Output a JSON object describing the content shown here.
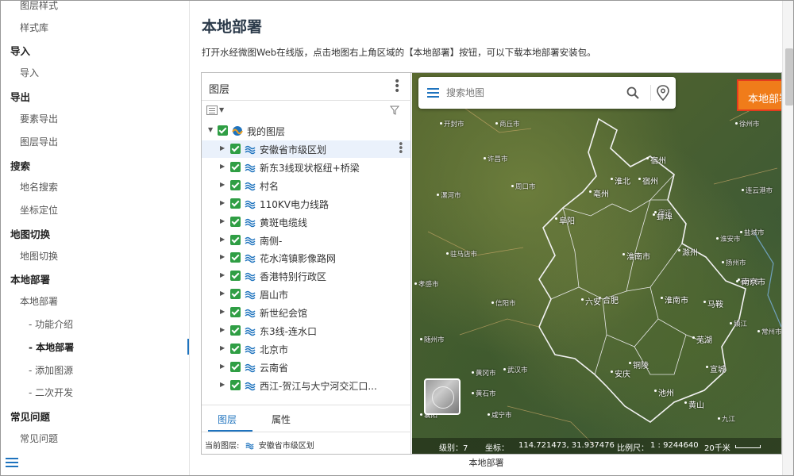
{
  "sidebar": {
    "items": [
      {
        "label": "图层样式",
        "level": 1,
        "active": false
      },
      {
        "label": "样式库",
        "level": 1,
        "active": false
      },
      {
        "label": "导入",
        "level": 0,
        "active": false
      },
      {
        "label": "导入",
        "level": 1,
        "active": false
      },
      {
        "label": "导出",
        "level": 0,
        "active": false
      },
      {
        "label": "要素导出",
        "level": 1,
        "active": false
      },
      {
        "label": "图层导出",
        "level": 1,
        "active": false
      },
      {
        "label": "搜索",
        "level": 0,
        "active": false
      },
      {
        "label": "地名搜索",
        "level": 1,
        "active": false
      },
      {
        "label": "坐标定位",
        "level": 1,
        "active": false
      },
      {
        "label": "地图切换",
        "level": 0,
        "active": false
      },
      {
        "label": "地图切换",
        "level": 1,
        "active": false
      },
      {
        "label": "本地部署",
        "level": 0,
        "active": false
      },
      {
        "label": "本地部署",
        "level": 1,
        "active": false
      },
      {
        "label": "- 功能介绍",
        "level": 2,
        "active": false
      },
      {
        "label": "- 本地部署",
        "level": 2,
        "active": true
      },
      {
        "label": "- 添加图源",
        "level": 2,
        "active": false
      },
      {
        "label": "- 二次开发",
        "level": 2,
        "active": false
      },
      {
        "label": "常见问题",
        "level": 0,
        "active": false
      },
      {
        "label": "常见问题",
        "level": 1,
        "active": false
      }
    ]
  },
  "content": {
    "title": "本地部署",
    "description": "打开水经微图Web在线版，点击地图右上角区域的【本地部署】按钮，可以下载本地部署安装包。",
    "caption": "本地部署"
  },
  "layer_panel": {
    "title": "图层",
    "root_label": "我的图层",
    "layers": [
      "安徽省市级区划",
      "新东3线现状枢纽+桥梁",
      "村名",
      "110KV电力线路",
      "黄斑电缆线",
      "南侧-",
      "花水湾镇影像路网",
      "香港特别行政区",
      "眉山市",
      "新世纪会馆",
      "东3线-连水口",
      "北京市",
      "云南省",
      "西江-贺江与大宁河交汇口..."
    ],
    "selected_index": 0,
    "tabs": [
      "图层",
      "属性"
    ],
    "active_tab": "图层",
    "current_layer_label": "当前图层:",
    "current_layer_value": "安徽省市级区划"
  },
  "map": {
    "search_placeholder": "搜索地图",
    "deploy_button": "本地部署",
    "status": {
      "level_label": "级别：",
      "level_value": "7",
      "coord_label": "坐标：",
      "coord_value": "114.721473, 31.937476",
      "scale_label": "比例尺：",
      "scale_value": "1 : 9244640",
      "distance": "20千米"
    },
    "cities": [
      "开封市",
      "商丘市",
      "徐州市",
      "许昌市",
      "宿州",
      "漯河市",
      "淮北",
      "宿州",
      "周口市",
      "亳州",
      "连云港市",
      "宿迁",
      "蚌埠",
      "淮安市",
      "盐城市",
      "阜阳",
      "驻马店市",
      "淮南市",
      "滁州",
      "扬州市",
      "泰州市",
      "南京市",
      "合肥",
      "马鞍",
      "信阳市",
      "随州市",
      "六安",
      "淮南市",
      "芜湖",
      "镇江",
      "常州市",
      "武汉市",
      "安庆",
      "铜陵",
      "池州",
      "宣城",
      "黄冈市",
      "黄石市",
      "九江",
      "黄山",
      "孝感市",
      "咸宁市",
      "襄阳"
    ]
  },
  "colors": {
    "accent": "#1e73be",
    "deploy_button": "#f07c1a",
    "checkbox": "#2f9e44",
    "title": "#2b3a4a"
  }
}
